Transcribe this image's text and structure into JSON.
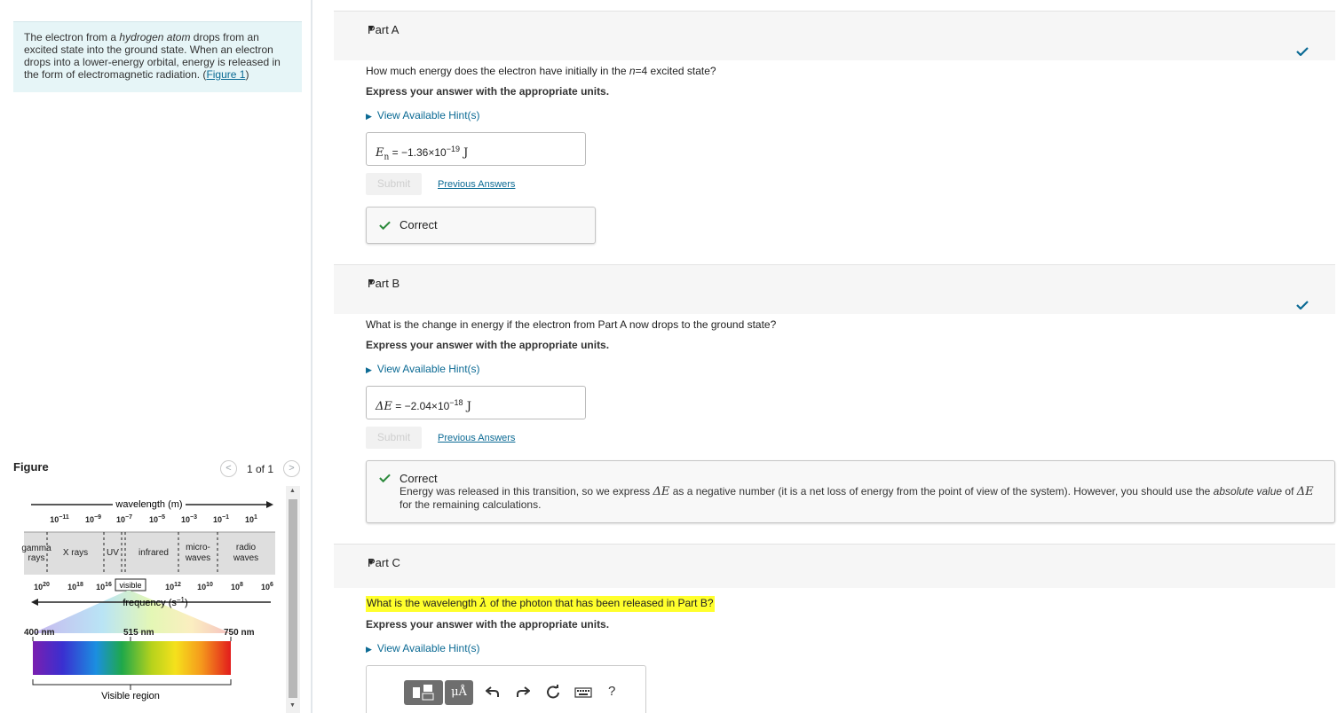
{
  "intro": {
    "t1": "The electron from a ",
    "t1_em": "hydrogen atom",
    "t2": " drops from an excited state into the ground state. When an electron drops into a lower-energy orbital, energy is released in the form of electromagnetic radiation. (",
    "fig_link": "Figure 1",
    "t3": ")"
  },
  "figure": {
    "title": "Figure",
    "count": "1 of 1",
    "prev_glyph": "<",
    "next_glyph": ">",
    "wavelength_label": "wavelength (m)",
    "frequency_label": "frequency (s",
    "frequency_exp": "−1",
    "frequency_close": ")",
    "wl_ticks": [
      {
        "base": "10",
        "exp": "−11"
      },
      {
        "base": "10",
        "exp": "−9"
      },
      {
        "base": "10",
        "exp": "−7"
      },
      {
        "base": "10",
        "exp": "−5"
      },
      {
        "base": "10",
        "exp": "−3"
      },
      {
        "base": "10",
        "exp": "−1"
      },
      {
        "base": "10",
        "exp": "1"
      }
    ],
    "freq_ticks": [
      {
        "base": "10",
        "exp": "20"
      },
      {
        "base": "10",
        "exp": "18"
      },
      {
        "base": "10",
        "exp": "16"
      },
      {
        "base": "10",
        "exp": "12"
      },
      {
        "base": "10",
        "exp": "10"
      },
      {
        "base": "10",
        "exp": "8"
      },
      {
        "base": "10",
        "exp": "6"
      }
    ],
    "bands": {
      "gamma1": "gamma",
      "gamma2": "rays",
      "xrays": "X rays",
      "uv": "UV",
      "infrared": "infrared",
      "micro1": "micro-",
      "micro2": "waves",
      "radio1": "radio",
      "radio2": "waves"
    },
    "visible_label": "visible",
    "nm_400": "400 nm",
    "nm_515": "515 nm",
    "nm_750": "750 nm",
    "visible_region": "Visible region"
  },
  "parts": {
    "a": {
      "label": "Part A",
      "question_pre": "How much energy does the electron have initially in the ",
      "question_var": "n",
      "question_post": "=4 excited state?",
      "instruction": "Express your answer with the appropriate units.",
      "hint": "View Available Hint(s)",
      "answer_var": "E",
      "answer_sub": "n",
      "answer_value": " = −1.36×10",
      "answer_exp": "−19",
      "answer_unit": " J",
      "submit": "Submit",
      "previous": "Previous Answers",
      "feedback_title": "Correct"
    },
    "b": {
      "label": "Part B",
      "question": "What is the change in energy if the electron from Part A now drops to the ground state?",
      "instruction": "Express your answer with the appropriate units.",
      "hint": "View Available Hint(s)",
      "answer_var": "ΔE",
      "answer_value": " = −2.04×10",
      "answer_exp": "−18",
      "answer_unit": " J",
      "submit": "Submit",
      "previous": "Previous Answers",
      "feedback_title": "Correct",
      "feedback_1": "Energy was released in this transition, so we express ",
      "feedback_var1": "ΔE",
      "feedback_2": " as a negative number (it is a net loss of energy from the point of view of the system). However, you should use the ",
      "feedback_em": "absolute value",
      "feedback_3": " of ",
      "feedback_var2": "ΔE",
      "feedback_4": " for the remaining calculations."
    },
    "c": {
      "label": "Part C",
      "question_pre": "What is the wavelength ",
      "question_var": "λ",
      "question_post": " of the photon that has been released in Part B?",
      "instruction": "Express your answer with the appropriate units.",
      "hint": "View Available Hint(s)",
      "units_button": "μÅ",
      "help": "?"
    }
  },
  "colors": {
    "accent": "#0b6a94",
    "correct_green": "#2c8a3c",
    "check_blue": "#0b6a94",
    "highlight": "#ffff2c",
    "intro_bg": "#e6f5f7"
  },
  "icons": [
    "check-icon",
    "triangle-down-icon",
    "triangle-right-icon",
    "undo-icon",
    "redo-icon",
    "reset-icon",
    "keyboard-icon",
    "templates-icon",
    "chevron-left-icon",
    "chevron-right-icon"
  ]
}
